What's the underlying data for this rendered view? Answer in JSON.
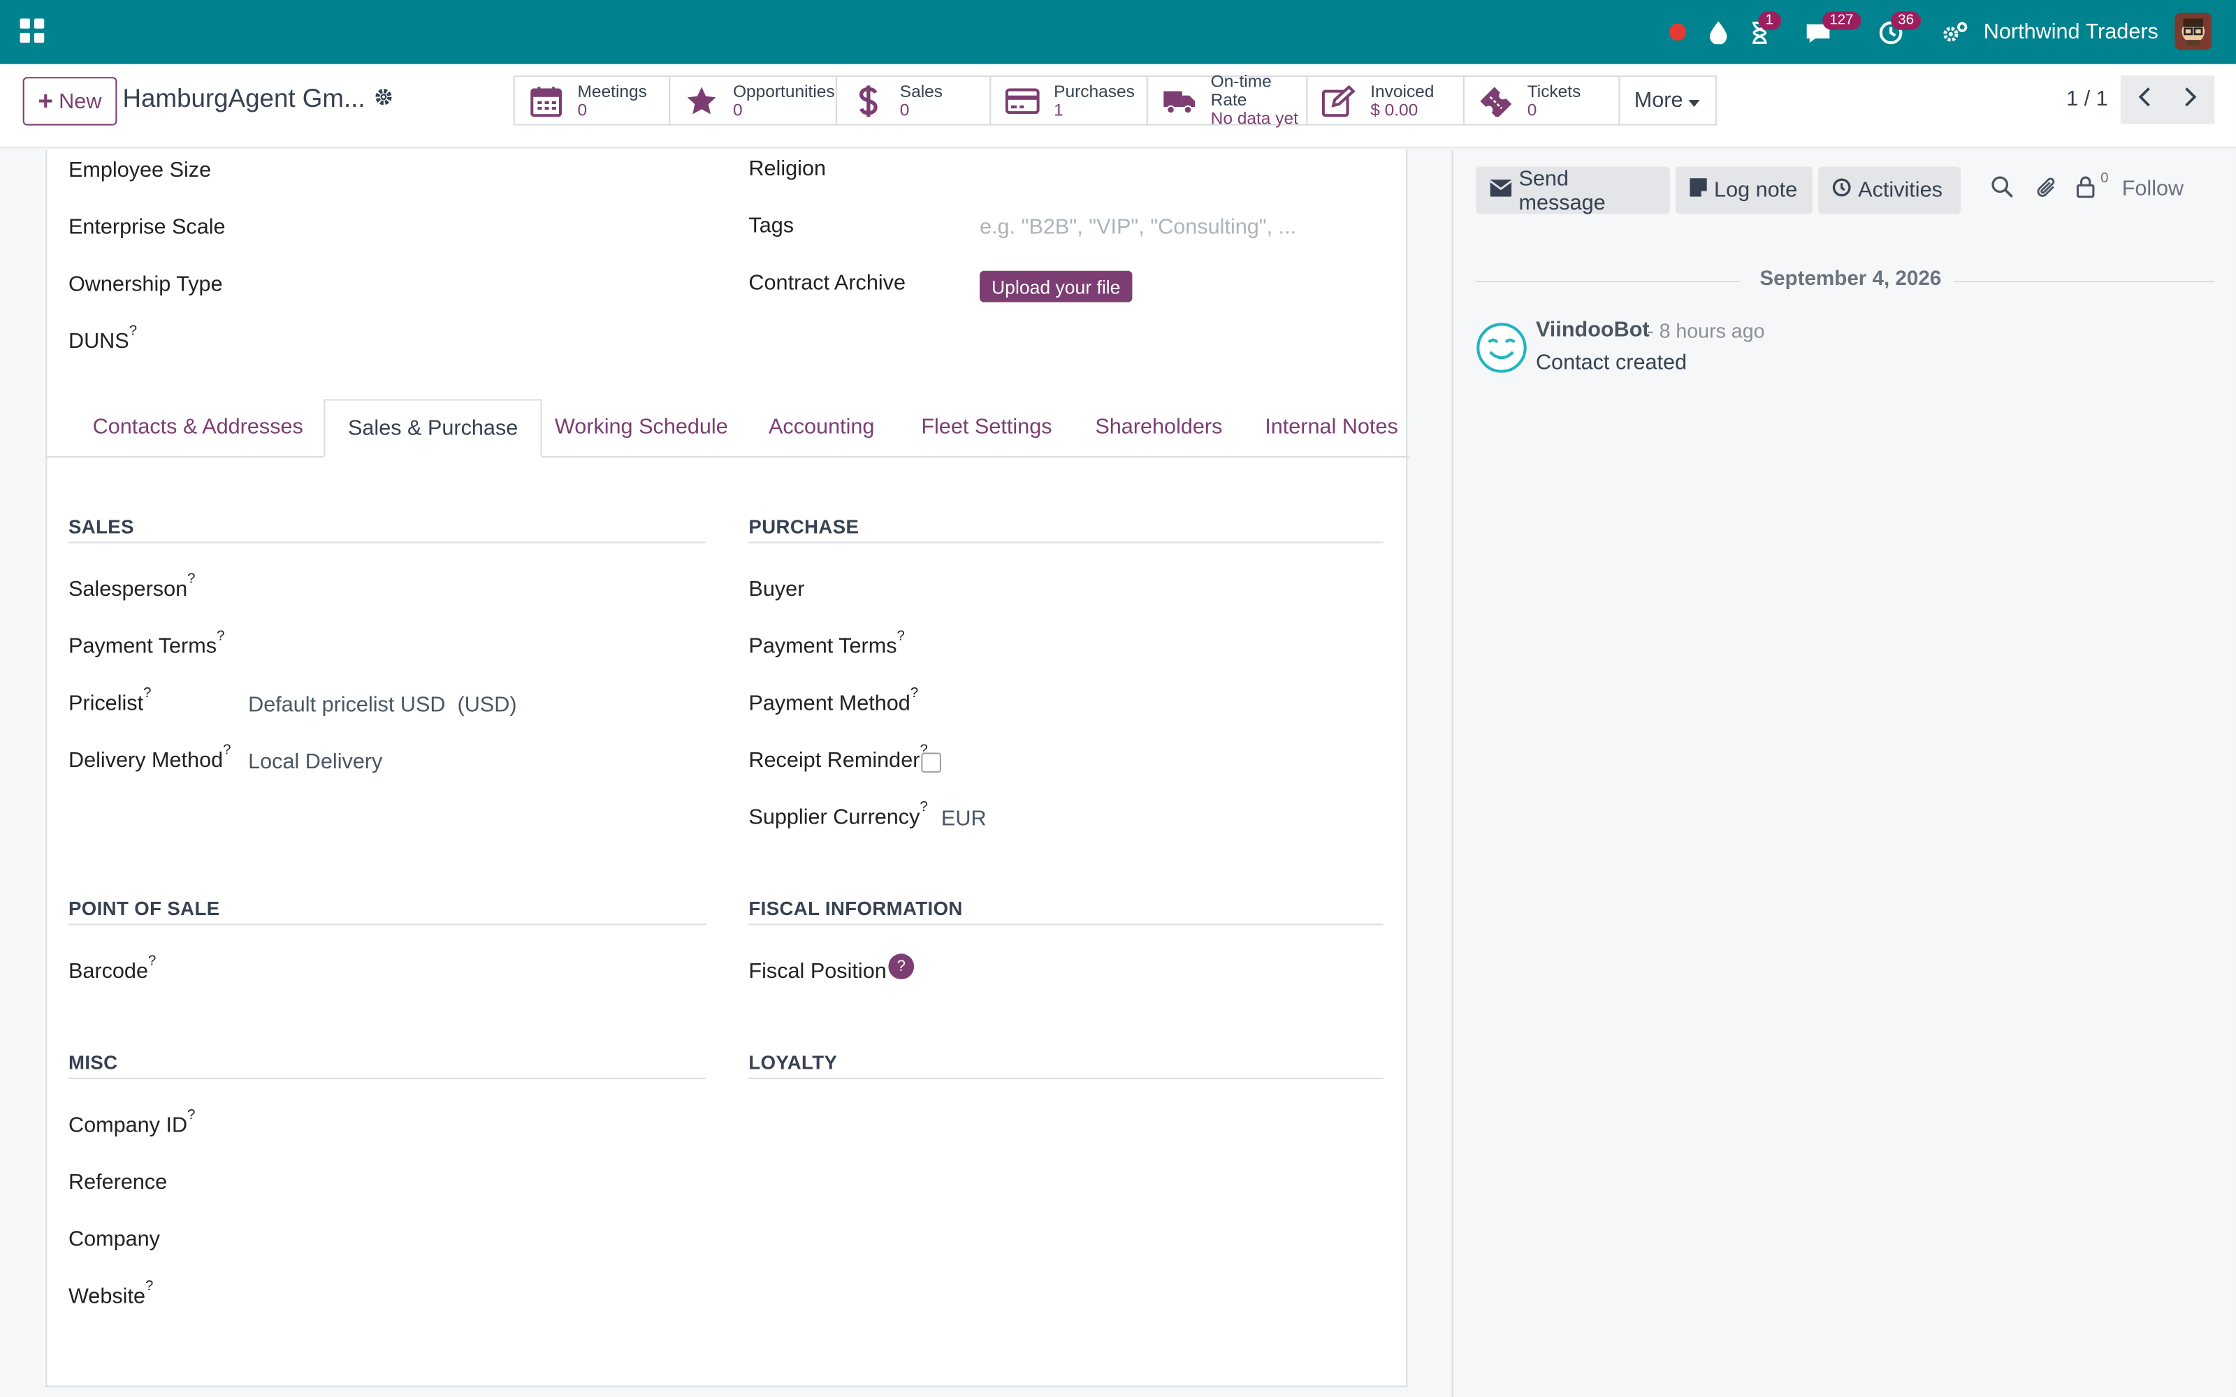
{
  "topbar": {
    "company": "Northwind Traders",
    "activity_badge": "1",
    "messages_badge": "127",
    "clock_badge": "36",
    "brand_color": "#00838f"
  },
  "control_panel": {
    "new_label": "New",
    "record_title": "HamburgAgent Gm...",
    "smart_buttons": [
      {
        "label": "Meetings",
        "value": "0",
        "icon": "calendar-icon"
      },
      {
        "label": "Opportunities",
        "value": "0",
        "icon": "star-icon"
      },
      {
        "label": "Sales",
        "value": "0",
        "icon": "dollar-icon"
      },
      {
        "label": "Purchases",
        "value": "1",
        "icon": "credit-card-icon"
      },
      {
        "label": "On-time Rate",
        "value": "No data yet",
        "icon": "truck-icon"
      },
      {
        "label": "Invoiced",
        "value": "$ 0.00",
        "icon": "edit-icon"
      },
      {
        "label": "Tickets",
        "value": "0",
        "icon": "ticket-icon"
      }
    ],
    "more_label": "More",
    "pager": "1 / 1"
  },
  "form": {
    "top_left": {
      "employee_size": "Employee Size",
      "enterprise_scale": "Enterprise Scale",
      "ownership_type": "Ownership Type",
      "duns": "DUNS"
    },
    "top_right": {
      "religion": "Religion",
      "tags": "Tags",
      "tags_placeholder": "e.g. \"B2B\", \"VIP\", \"Consulting\", ...",
      "contract_archive": "Contract Archive",
      "upload_label": "Upload your file"
    },
    "tabs": [
      "Contacts & Addresses",
      "Sales & Purchase",
      "Working Schedule",
      "Accounting",
      "Fleet Settings",
      "Shareholders",
      "Internal Notes"
    ],
    "sales": {
      "title": "SALES",
      "salesperson": "Salesperson",
      "payment_terms": "Payment Terms",
      "pricelist": "Pricelist",
      "pricelist_value": "Default pricelist USD  (USD)",
      "delivery_method": "Delivery Method",
      "delivery_method_value": "Local Delivery"
    },
    "purchase": {
      "title": "PURCHASE",
      "buyer": "Buyer",
      "payment_terms": "Payment Terms",
      "payment_method": "Payment Method",
      "receipt_reminder": "Receipt Reminder",
      "supplier_currency": "Supplier Currency",
      "supplier_currency_value": "EUR"
    },
    "pos": {
      "title": "POINT OF SALE",
      "barcode": "Barcode"
    },
    "fiscal": {
      "title": "FISCAL INFORMATION",
      "fiscal_position": "Fiscal Position",
      "help": "?"
    },
    "misc": {
      "title": "MISC",
      "company_id": "Company ID",
      "reference": "Reference",
      "company": "Company",
      "website": "Website"
    },
    "loyalty": {
      "title": "LOYALTY"
    },
    "help_mark": "?"
  },
  "chatter": {
    "send_message": "Send message",
    "log_note": "Log note",
    "activities": "Activities",
    "followers_count": "0",
    "follow": "Follow",
    "date": "September 4, 2026",
    "author": "ViindooBot",
    "time_ago": "- 8 hours ago",
    "message": "Contact created"
  }
}
